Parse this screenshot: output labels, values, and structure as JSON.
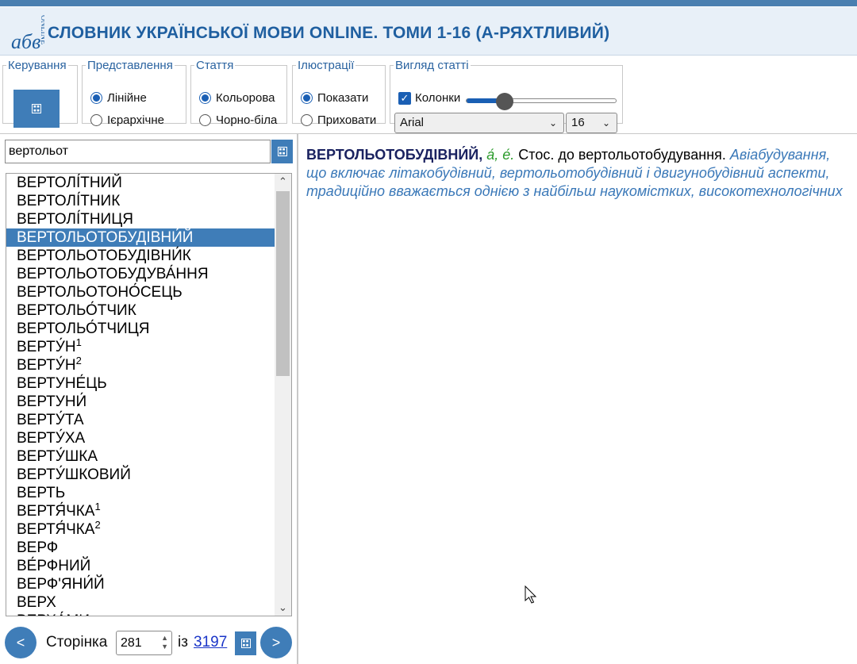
{
  "header": {
    "logo_text": "абв ONLINE",
    "title": "СЛОВНИК УКРАЇНСЬКОЇ МОВИ ONLINE. ТОМИ 1-16 (А-РЯХТЛИВИЙ)"
  },
  "toolbar": {
    "control": {
      "legend": "Керування",
      "button_icon": "keyboard-icon"
    },
    "view": {
      "legend": "Представлення",
      "linear": "Лінійне",
      "hierarchical": "Ієрархічне",
      "selected": "Лінійне"
    },
    "article": {
      "legend": "Стаття",
      "color": "Кольорова",
      "bw": "Чорно-біла",
      "selected": "Кольорова"
    },
    "illustrations": {
      "legend": "Ілюстрації",
      "show": "Показати",
      "hide": "Приховати",
      "selected": "Показати"
    },
    "appearance": {
      "legend": "Вигляд статті",
      "columns": "Колонки",
      "columns_checked": true,
      "slider_level": 0.25,
      "font": "Arial",
      "size": "16"
    }
  },
  "search": {
    "value": "вертольот",
    "button_icon": "keyboard-icon"
  },
  "word_list": {
    "items": [
      {
        "text": "ВЕРТОЛІ́ТНИЙ",
        "sup": ""
      },
      {
        "text": "ВЕРТОЛІ́ТНИК",
        "sup": ""
      },
      {
        "text": "ВЕРТОЛІ́ТНИЦЯ",
        "sup": ""
      },
      {
        "text": "ВЕРТОЛЬОТОБУДІВНИ́Й",
        "sup": "",
        "selected": true
      },
      {
        "text": "ВЕРТОЛЬОТОБУДІВНИ́К",
        "sup": ""
      },
      {
        "text": "ВЕРТОЛЬОТОБУДУВА́ННЯ",
        "sup": ""
      },
      {
        "text": "ВЕРТОЛЬОТОНО́СЕЦЬ",
        "sup": ""
      },
      {
        "text": "ВЕРТОЛЬО́ТЧИК",
        "sup": ""
      },
      {
        "text": "ВЕРТОЛЬО́ТЧИЦЯ",
        "sup": ""
      },
      {
        "text": "ВЕРТУ́Н",
        "sup": "1"
      },
      {
        "text": "ВЕРТУ́Н",
        "sup": "2"
      },
      {
        "text": "ВЕРТУНЕ́ЦЬ",
        "sup": ""
      },
      {
        "text": "ВЕРТУНИ́",
        "sup": ""
      },
      {
        "text": "ВЕРТУ́ТА",
        "sup": ""
      },
      {
        "text": "ВЕРТУ́ХА",
        "sup": ""
      },
      {
        "text": "ВЕРТУ́ШКА",
        "sup": ""
      },
      {
        "text": "ВЕРТУ́ШКОВИЙ",
        "sup": ""
      },
      {
        "text": "ВЕРТЬ",
        "sup": ""
      },
      {
        "text": "ВЕРТЯ́ЧКА",
        "sup": "1"
      },
      {
        "text": "ВЕРТЯ́ЧКА",
        "sup": "2"
      },
      {
        "text": "ВЕРФ",
        "sup": ""
      },
      {
        "text": "ВЕ́РФНИЙ",
        "sup": ""
      },
      {
        "text": "ВЕРФ'ЯНИ́Й",
        "sup": ""
      },
      {
        "text": "ВЕРХ",
        "sup": ""
      },
      {
        "text": "ВЕРХА́МИ",
        "sup": ""
      }
    ]
  },
  "pager": {
    "prev": "<",
    "next": ">",
    "label": "Сторінка",
    "current": "281",
    "of": "із",
    "total": "3197",
    "goto_icon": "keyboard-icon"
  },
  "article": {
    "headword": "ВЕРТОЛЬОТОБУДІВНИ́Й,",
    "grammar": "а́, е́.",
    "definition": "Стос. до вертольотобудування.",
    "example_line1": "Авіабудування,",
    "example_line2": "що включає літакобудівний, вертольотобудівний і двигунобудівний аспекти,",
    "example_line3": "традиційно вважається однією з найбільш наукомістких, високотехнологічних"
  },
  "colors": {
    "accent": "#3f7db8",
    "title": "#1f5fa0",
    "headword": "#1a2260",
    "grammar": "#2a9a2a",
    "example": "#3a78b8"
  }
}
